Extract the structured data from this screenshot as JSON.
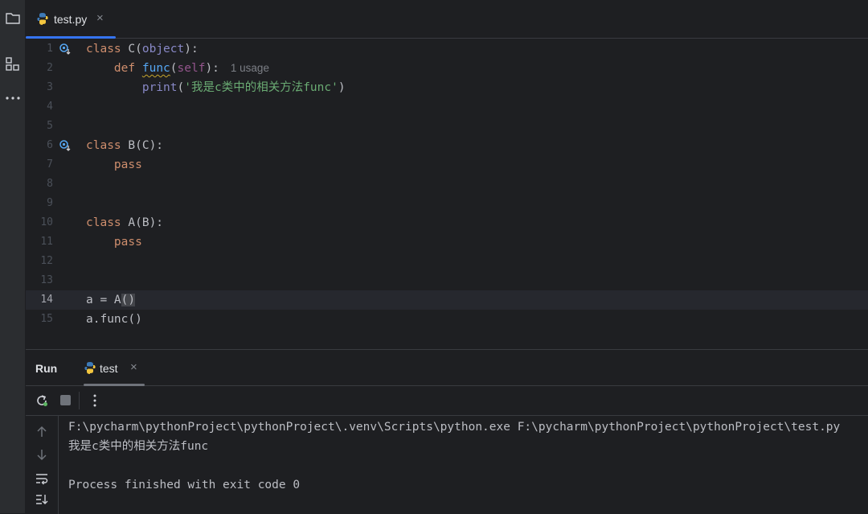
{
  "tab": {
    "filename": "test.py",
    "close": "×"
  },
  "left_toolbar": {
    "icons": [
      "folder-icon",
      "structure-icon",
      "more-icon"
    ]
  },
  "editor": {
    "usage_hint": "1 usage",
    "line_numbers": [
      "1",
      "2",
      "3",
      "4",
      "5",
      "6",
      "7",
      "8",
      "9",
      "10",
      "11",
      "12",
      "13",
      "14",
      "15"
    ],
    "current_line": 14,
    "code": {
      "l1": {
        "kw": "class",
        "rest": " C(",
        "builtin": "object",
        "end": "):"
      },
      "l2": {
        "kw": "def",
        "fn": "func",
        "open": "(",
        "self": "self",
        "end": "):"
      },
      "l3": {
        "builtin": "print",
        "open": "(",
        "str": "'我是c类中的相关方法func'",
        "end": ")"
      },
      "l6": {
        "kw": "class",
        "rest": " B(C):"
      },
      "l7": {
        "kw": "pass"
      },
      "l10": {
        "kw": "class",
        "rest": " A(B):"
      },
      "l11": {
        "kw": "pass"
      },
      "l14": {
        "text": "a = A",
        "paren": "()"
      },
      "l15": {
        "text": "a.func()"
      }
    }
  },
  "run_panel": {
    "title": "Run",
    "tab_label": "test",
    "tab_close": "×",
    "toolbar_icons": [
      "rerun-icon",
      "stop-icon",
      "more-vertical-icon"
    ],
    "side_icons": [
      "scroll-up-icon",
      "scroll-down-icon",
      "soft-wrap-icon",
      "scroll-to-end-icon"
    ],
    "output": [
      "F:\\pycharm\\pythonProject\\pythonProject\\.venv\\Scripts\\python.exe F:\\pycharm\\pythonProject\\pythonProject\\test.py",
      "我是c类中的相关方法func",
      "",
      "Process finished with exit code 0"
    ]
  },
  "colors": {
    "accent": "#3574f0",
    "keyword": "#cf8e6d",
    "function": "#56a8f5",
    "string": "#6aab73",
    "self": "#94558d",
    "builtin": "#8888c6"
  }
}
